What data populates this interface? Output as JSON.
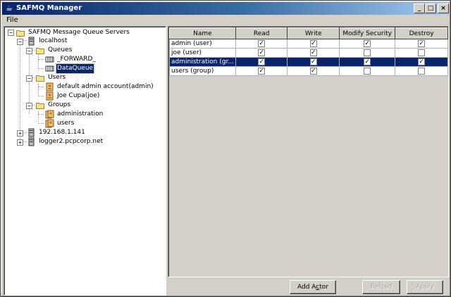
{
  "window": {
    "title": "SAFMQ Manager"
  },
  "menubar": {
    "file_label": "File"
  },
  "tree": {
    "root": "SAFMQ Message Queue Servers",
    "localhost": "localhost",
    "queues": "Queues",
    "forward_queue": "_FORWARD_",
    "data_queue": "DataQueue",
    "users": "Users",
    "user_admin": "default admin account(admin)",
    "user_joe": "Joe Cupa(joe)",
    "groups": "Groups",
    "group_admin": "administration",
    "group_users": "users",
    "server2": "192.168.1.141",
    "server3": "logger2.pcpcorp.net"
  },
  "table": {
    "columns": [
      "Name",
      "Read",
      "Write",
      "Modify Security",
      "Destroy"
    ],
    "rows": [
      {
        "name": "admin (user)",
        "read": true,
        "write": true,
        "modify": true,
        "destroy": true,
        "selected": false
      },
      {
        "name": "joe (user)",
        "read": true,
        "write": true,
        "modify": false,
        "destroy": false,
        "selected": false
      },
      {
        "name": "administration (gr...",
        "read": true,
        "write": true,
        "modify": true,
        "destroy": true,
        "selected": true
      },
      {
        "name": "users (group)",
        "read": true,
        "write": true,
        "modify": false,
        "destroy": false,
        "selected": false
      }
    ]
  },
  "buttons": {
    "add_actor_pre": "Add A",
    "add_actor_ul": "c",
    "add_actor_post": "tor",
    "reload": "Reload",
    "apply": "Apply"
  },
  "colors": {
    "selection": "#0a246a",
    "chrome": "#d4d0c8"
  }
}
